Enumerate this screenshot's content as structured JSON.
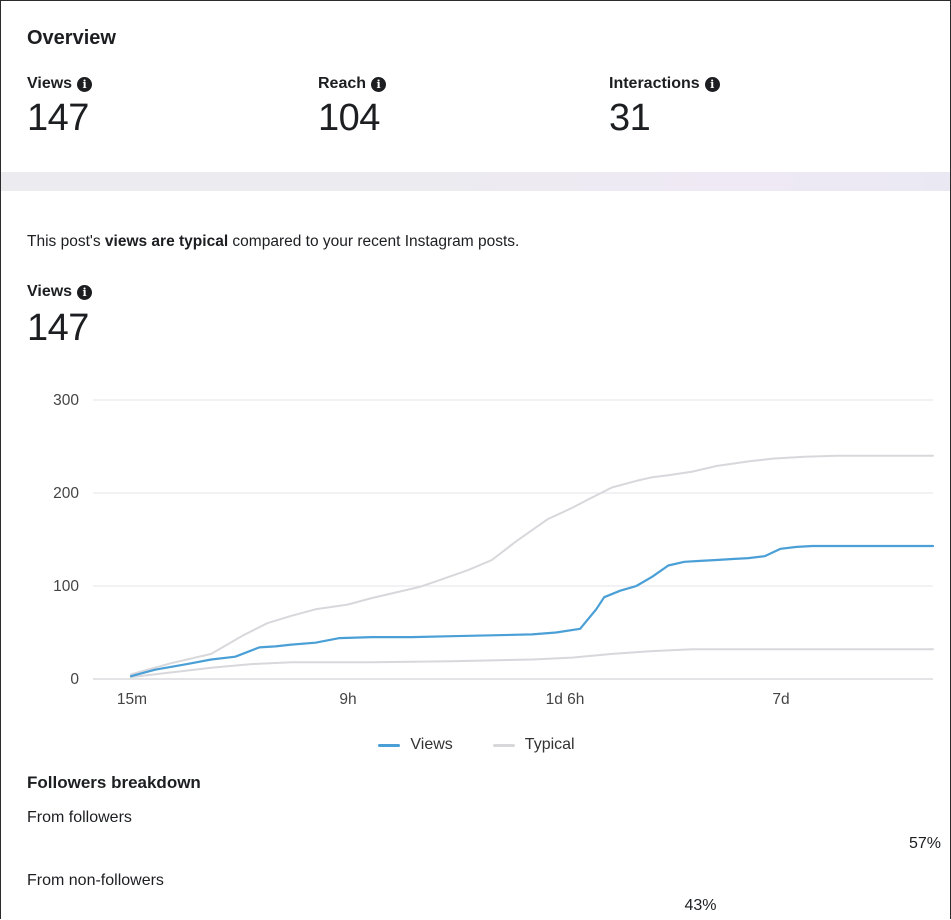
{
  "overview": {
    "title": "Overview",
    "metrics": [
      {
        "label": "Views",
        "value": "147"
      },
      {
        "label": "Reach",
        "value": "104"
      },
      {
        "label": "Interactions",
        "value": "31"
      }
    ]
  },
  "summary": {
    "prefix": "This post's ",
    "emphasis": "views are typical",
    "suffix": " compared to your recent Instagram posts."
  },
  "views_detail": {
    "label": "Views",
    "value": "147"
  },
  "colors": {
    "views": "#4a9fd6",
    "typical": "#d8d8dc",
    "text": "#1c1e21"
  },
  "icons": {
    "info": "info-icon"
  },
  "chart_data": {
    "type": "line",
    "x_ticks": [
      "15m",
      "9h",
      "1d 6h",
      "7d"
    ],
    "y_ticks": [
      0,
      100,
      200,
      300
    ],
    "ylim": [
      0,
      300
    ],
    "grid": true,
    "legend_position": "bottom",
    "series": [
      {
        "name": "Views",
        "color": "#4a9fd6",
        "x": [
          0,
          0.03,
          0.07,
          0.1,
          0.13,
          0.16,
          0.18,
          0.2,
          0.23,
          0.26,
          0.3,
          0.35,
          0.4,
          0.45,
          0.5,
          0.53,
          0.56,
          0.58,
          0.59,
          0.61,
          0.63,
          0.65,
          0.67,
          0.69,
          0.71,
          0.73,
          0.75,
          0.77,
          0.79,
          0.81,
          0.83,
          0.85,
          0.87,
          0.9,
          0.94,
          1.0
        ],
        "y": [
          3,
          10,
          16,
          21,
          24,
          34,
          35,
          37,
          39,
          44,
          45,
          45,
          46,
          47,
          48,
          50,
          54,
          75,
          88,
          95,
          100,
          110,
          122,
          126,
          127,
          128,
          129,
          130,
          132,
          140,
          142,
          143,
          143,
          143,
          143,
          143
        ]
      },
      {
        "name": "Typical",
        "color": "#d8d8dc",
        "x": [
          0,
          0.05,
          0.1,
          0.14,
          0.17,
          0.2,
          0.23,
          0.27,
          0.3,
          0.33,
          0.36,
          0.38,
          0.42,
          0.45,
          0.48,
          0.5,
          0.52,
          0.53,
          0.55,
          0.57,
          0.6,
          0.63,
          0.65,
          0.67,
          0.7,
          0.73,
          0.77,
          0.8,
          0.84,
          0.88,
          0.92,
          1.0
        ],
        "y": [
          5,
          17,
          27,
          47,
          60,
          68,
          75,
          80,
          87,
          93,
          99,
          105,
          117,
          128,
          148,
          160,
          172,
          176,
          184,
          193,
          206,
          213,
          217,
          219,
          223,
          229,
          234,
          237,
          239,
          240,
          240,
          240
        ]
      },
      {
        "name": "",
        "color": "#d8d8dc",
        "x": [
          0,
          0.1,
          0.15,
          0.2,
          0.3,
          0.4,
          0.45,
          0.5,
          0.55,
          0.6,
          0.65,
          0.7,
          0.75,
          0.8,
          0.9,
          1.0
        ],
        "y": [
          2,
          12,
          16,
          18,
          18,
          19,
          20,
          21,
          23,
          27,
          30,
          32,
          32,
          32,
          32,
          32
        ]
      }
    ]
  },
  "legend": {
    "views": "Views",
    "typical": "Typical"
  },
  "followers_breakdown": {
    "title": "Followers breakdown",
    "from_followers": {
      "label": "From followers",
      "percent": "57%",
      "share": 0.57
    },
    "from_non_followers": {
      "label": "From non-followers",
      "percent": "43%",
      "share": 0.43
    }
  }
}
